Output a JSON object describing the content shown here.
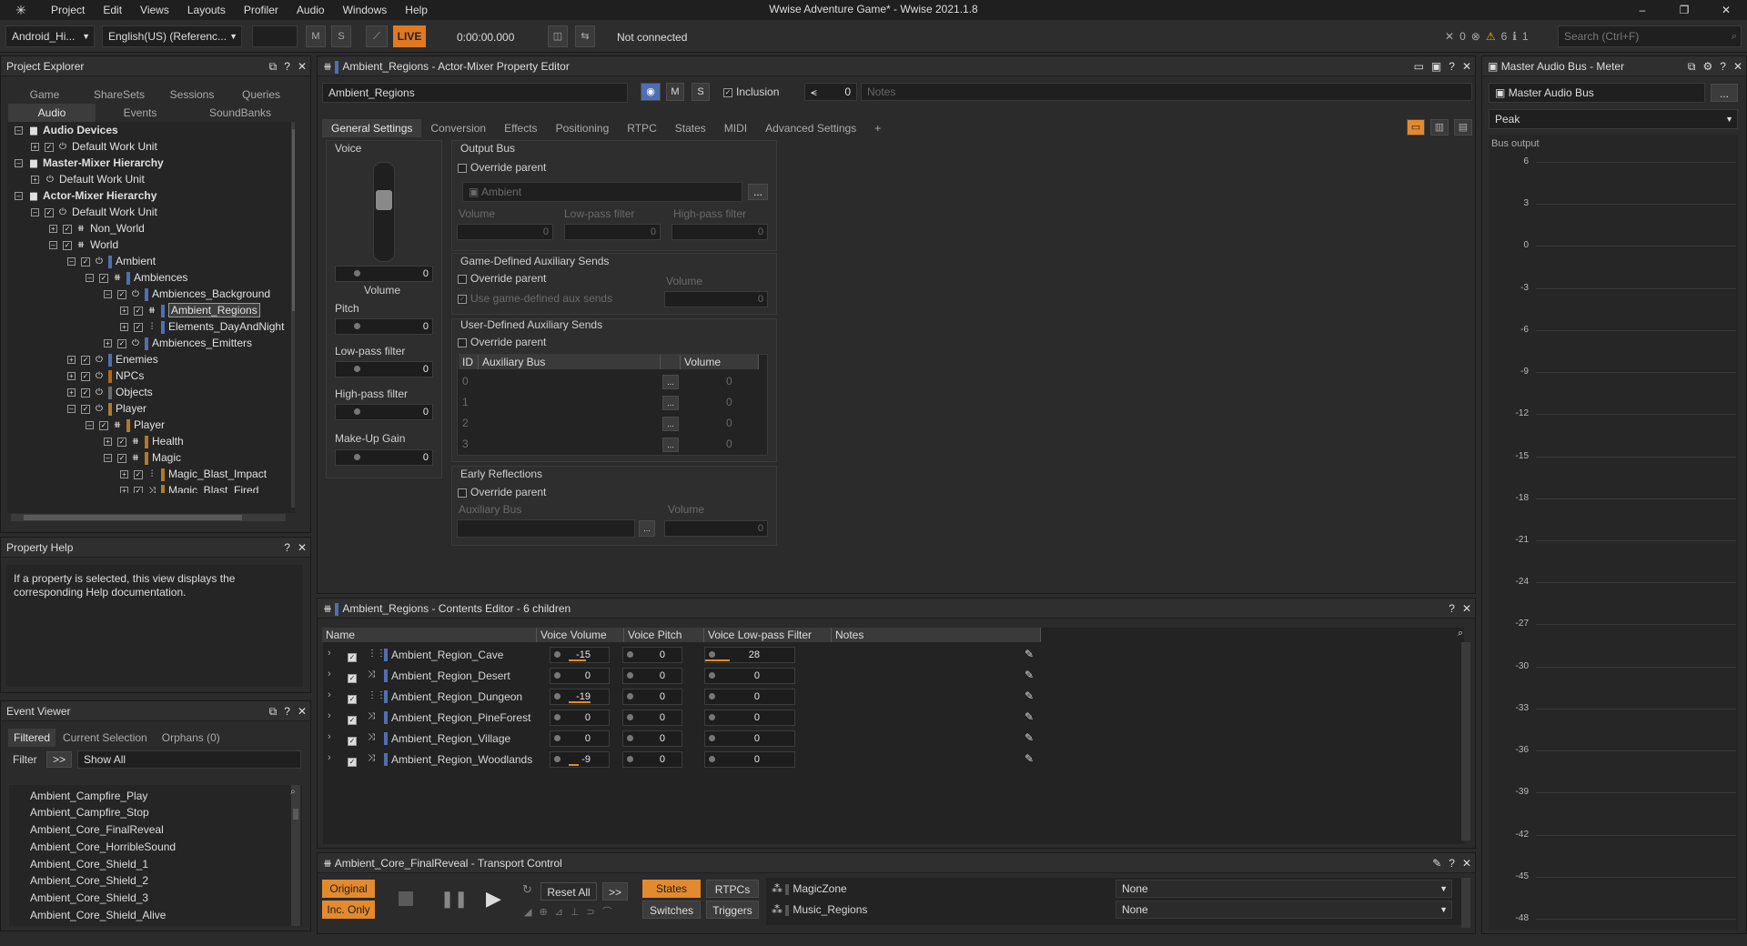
{
  "app": {
    "title": "Wwise Adventure Game* - Wwise 2021.1.8",
    "menu": [
      "Project",
      "Edit",
      "Views",
      "Layouts",
      "Profiler",
      "Audio",
      "Windows",
      "Help"
    ]
  },
  "toolbar": {
    "platform": "Android_Hi...",
    "language": "English(US) (Referenc...",
    "m": "M",
    "s": "S",
    "live": "LIVE",
    "timecode": "0:00:00.000",
    "connection": "Not connected",
    "errors": "0",
    "warnings": "6",
    "infos": "1",
    "search_placeholder": "Search (Ctrl+F)"
  },
  "project_explorer": {
    "title": "Project Explorer",
    "tabs_top": [
      "Game Syncs",
      "ShareSets",
      "Sessions",
      "Queries"
    ],
    "tabs_bottom": [
      "Audio",
      "Events",
      "SoundBanks"
    ],
    "tree": [
      {
        "label": "Audio Devices",
        "depth": 0,
        "bold": true
      },
      {
        "label": "Default Work Unit",
        "depth": 1
      },
      {
        "label": "Master-Mixer Hierarchy",
        "depth": 0,
        "bold": true
      },
      {
        "label": "Default Work Unit",
        "depth": 1
      },
      {
        "label": "Actor-Mixer Hierarchy",
        "depth": 0,
        "bold": true
      },
      {
        "label": "Default Work Unit",
        "depth": 1
      },
      {
        "label": "Non_World",
        "depth": 2
      },
      {
        "label": "World",
        "depth": 2
      },
      {
        "label": "Ambient",
        "depth": 3
      },
      {
        "label": "Ambiences",
        "depth": 4
      },
      {
        "label": "Ambiences_Background",
        "depth": 5
      },
      {
        "label": "Ambient_Regions",
        "depth": 6,
        "selected": true
      },
      {
        "label": "Elements_DayAndNight",
        "depth": 6
      },
      {
        "label": "Ambiences_Emitters",
        "depth": 5
      },
      {
        "label": "Enemies",
        "depth": 3
      },
      {
        "label": "NPCs",
        "depth": 3
      },
      {
        "label": "Objects",
        "depth": 3
      },
      {
        "label": "Player",
        "depth": 3
      },
      {
        "label": "Player",
        "depth": 4
      },
      {
        "label": "Health",
        "depth": 5
      },
      {
        "label": "Magic",
        "depth": 5
      },
      {
        "label": "Magic_Blast_Impact",
        "depth": 6
      },
      {
        "label": "Magic_Blast_Fired",
        "depth": 6
      }
    ]
  },
  "property_help": {
    "title": "Property Help",
    "text": "If a property is selected, this view displays the corresponding Help documentation."
  },
  "event_viewer": {
    "title": "Event Viewer",
    "tabs": [
      "Filtered",
      "Current Selection",
      "Orphans (0)"
    ],
    "filter_label": "Filter",
    "filter_btn": ">>",
    "filter_value": "Show All",
    "events": [
      "Ambient_Campfire_Play",
      "Ambient_Campfire_Stop",
      "Ambient_Core_FinalReveal",
      "Ambient_Core_HorribleSound",
      "Ambient_Core_Shield_1",
      "Ambient_Core_Shield_2",
      "Ambient_Core_Shield_3",
      "Ambient_Core_Shield_Alive"
    ]
  },
  "property_editor": {
    "title": "Ambient_Regions - Actor-Mixer Property Editor",
    "name": "Ambient_Regions",
    "m": "M",
    "s": "S",
    "inclusion": "Inclusion",
    "notes_placeholder": "Notes",
    "link_count": "0",
    "tabs": [
      "General Settings",
      "Conversion",
      "Effects",
      "Positioning",
      "RTPC",
      "States",
      "MIDI",
      "Advanced Settings",
      "+"
    ],
    "voice": {
      "label": "Voice",
      "volume_label": "Volume",
      "volume": "0",
      "pitch_label": "Pitch",
      "pitch": "0",
      "lpf_label": "Low-pass filter",
      "lpf": "0",
      "hpf_label": "High-pass filter",
      "hpf": "0",
      "makeup_label": "Make-Up Gain",
      "makeup": "0"
    },
    "output_bus": {
      "label": "Output Bus",
      "override": "Override parent",
      "bus": "Ambient",
      "volume": "Volume",
      "lpf": "Low-pass filter",
      "hpf": "High-pass filter",
      "v1": "0",
      "v2": "0",
      "v3": "0"
    },
    "game_aux": {
      "label": "Game-Defined Auxiliary Sends",
      "override": "Override parent",
      "use": "Use game-defined aux sends",
      "volume": "Volume",
      "v": "0"
    },
    "user_aux": {
      "label": "User-Defined Auxiliary Sends",
      "override": "Override parent",
      "col_id": "ID",
      "col_bus": "Auxiliary Bus",
      "col_vol": "Volume",
      "ids": [
        "0",
        "1",
        "2",
        "3"
      ],
      "vals": [
        "0",
        "0",
        "0",
        "0"
      ]
    },
    "early": {
      "label": "Early Reflections",
      "override": "Override parent",
      "bus": "Auxiliary Bus",
      "volume": "Volume",
      "v": "0"
    }
  },
  "contents_editor": {
    "title": "Ambient_Regions - Contents Editor - 6 children",
    "cols": [
      "Name",
      "Voice Volume",
      "Voice Pitch",
      "Voice Low-pass Filter",
      "Notes"
    ],
    "rows": [
      {
        "name": "Ambient_Region_Cave",
        "vol": "-15",
        "pitch": "0",
        "lpf": "28",
        "icon": "blend"
      },
      {
        "name": "Ambient_Region_Desert",
        "vol": "0",
        "pitch": "0",
        "lpf": "0",
        "icon": "random"
      },
      {
        "name": "Ambient_Region_Dungeon",
        "vol": "-19",
        "pitch": "0",
        "lpf": "0",
        "icon": "blend"
      },
      {
        "name": "Ambient_Region_PineForest",
        "vol": "0",
        "pitch": "0",
        "lpf": "0",
        "icon": "random"
      },
      {
        "name": "Ambient_Region_Village",
        "vol": "0",
        "pitch": "0",
        "lpf": "0",
        "icon": "random"
      },
      {
        "name": "Ambient_Region_Woodlands",
        "vol": "-9",
        "pitch": "0",
        "lpf": "0",
        "icon": "random"
      }
    ]
  },
  "transport": {
    "title": "Ambient_Core_FinalReveal - Transport Control",
    "original": "Original",
    "inc_only": "Inc. Only",
    "reset_all": "Reset All",
    "more": ">>",
    "states": "States",
    "rtpcs": "RTPCs",
    "switches": "Switches",
    "triggers": "Triggers",
    "groups": [
      {
        "name": "MagicZone",
        "value": "None"
      },
      {
        "name": "Music_Regions",
        "value": "None"
      }
    ]
  },
  "meter": {
    "title": "Master Audio Bus - Meter",
    "bus": "Master Audio Bus",
    "mode": "Peak",
    "label": "Bus output",
    "more": "...",
    "ticks": [
      "6",
      "3",
      "0",
      "-3",
      "-6",
      "-9",
      "-12",
      "-15",
      "-18",
      "-21",
      "-24",
      "-27",
      "-30",
      "-33",
      "-36",
      "-39",
      "-42",
      "-45",
      "-48"
    ]
  },
  "colors": {
    "accent": "#e38a2e",
    "selection": "#4f6fb3",
    "panel": "#2b2b2b"
  }
}
